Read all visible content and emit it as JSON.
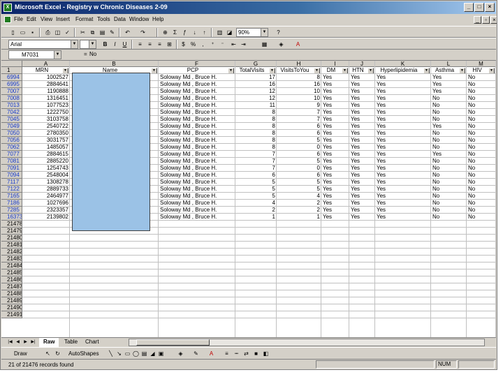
{
  "window": {
    "title": "Microsoft Excel - Registry w Chronic Diseases 2-09",
    "minimize": "_",
    "maximize": "□",
    "close": "×"
  },
  "menu": [
    "File",
    "Edit",
    "View",
    "Insert",
    "Format",
    "Tools",
    "Data",
    "Window",
    "Help"
  ],
  "formatting": {
    "font": "Arial",
    "font_size": "10",
    "zoom": "90%"
  },
  "formula_bar": {
    "name_box": "M7031",
    "fx": "=",
    "value": "No"
  },
  "columns": [
    {
      "letter": "A",
      "header": "MRN"
    },
    {
      "letter": "B",
      "header": "Name"
    },
    {
      "letter": "F",
      "header": "PCP"
    },
    {
      "letter": "G",
      "header": "TotalVisits"
    },
    {
      "letter": "H",
      "header": "VisitsToYou"
    },
    {
      "letter": "I",
      "header": "DM"
    },
    {
      "letter": "J",
      "header": "HTN"
    },
    {
      "letter": "K",
      "header": "Hyperlipidemia"
    },
    {
      "letter": "L",
      "header": "Asthma"
    },
    {
      "letter": "M",
      "header": "HIV"
    }
  ],
  "header_row_number": "1",
  "rows": [
    {
      "row": "6994",
      "mrn": "1002527",
      "pcp": "Soloway Md , Bruce H.",
      "total": "17",
      "you": "8",
      "dm": "Yes",
      "htn": "Yes",
      "hyp": "Yes",
      "asthma": "Yes",
      "hiv": "No"
    },
    {
      "row": "6995",
      "mrn": "2884641",
      "pcp": "Soloway Md , Bruce H.",
      "total": "16",
      "you": "16",
      "dm": "Yes",
      "htn": "Yes",
      "hyp": "Yes",
      "asthma": "Yes",
      "hiv": "No"
    },
    {
      "row": "7007",
      "mrn": "1190888",
      "pcp": "Soloway Md , Bruce H.",
      "total": "12",
      "you": "10",
      "dm": "Yes",
      "htn": "Yes",
      "hyp": "Yes",
      "asthma": "Yes",
      "hiv": "No"
    },
    {
      "row": "7008",
      "mrn": "1316451",
      "pcp": "Soloway Md , Bruce H.",
      "total": "12",
      "you": "10",
      "dm": "Yes",
      "htn": "Yes",
      "hyp": "Yes",
      "asthma": "No",
      "hiv": "No"
    },
    {
      "row": "7013",
      "mrn": "1077523",
      "pcp": "Soloway Md , Bruce H.",
      "total": "11",
      "you": "9",
      "dm": "Yes",
      "htn": "Yes",
      "hyp": "Yes",
      "asthma": "No",
      "hiv": "No"
    },
    {
      "row": "7042",
      "mrn": "1222750",
      "pcp": "Soloway Md , Bruce H.",
      "total": "8",
      "you": "7",
      "dm": "Yes",
      "htn": "Yes",
      "hyp": "Yes",
      "asthma": "No",
      "hiv": "No"
    },
    {
      "row": "7045",
      "mrn": "3103758",
      "pcp": "Soloway Md , Bruce H.",
      "total": "8",
      "you": "7",
      "dm": "Yes",
      "htn": "Yes",
      "hyp": "Yes",
      "asthma": "No",
      "hiv": "No"
    },
    {
      "row": "7049",
      "mrn": "2540722",
      "pcp": "Soloway Md , Bruce H.",
      "total": "8",
      "you": "6",
      "dm": "Yes",
      "htn": "Yes",
      "hyp": "Yes",
      "asthma": "Yes",
      "hiv": "No"
    },
    {
      "row": "7050",
      "mrn": "2780350",
      "pcp": "Soloway Md , Bruce H.",
      "total": "8",
      "you": "6",
      "dm": "Yes",
      "htn": "Yes",
      "hyp": "Yes",
      "asthma": "No",
      "hiv": "No"
    },
    {
      "row": "7056",
      "mrn": "3031757",
      "pcp": "Soloway Md , Bruce H.",
      "total": "8",
      "you": "5",
      "dm": "Yes",
      "htn": "Yes",
      "hyp": "Yes",
      "asthma": "No",
      "hiv": "No"
    },
    {
      "row": "7062",
      "mrn": "1485057",
      "pcp": "Soloway Md , Bruce H.",
      "total": "8",
      "you": "0",
      "dm": "Yes",
      "htn": "Yes",
      "hyp": "Yes",
      "asthma": "No",
      "hiv": "No"
    },
    {
      "row": "7077",
      "mrn": "2884615",
      "pcp": "Soloway Md , Bruce H.",
      "total": "7",
      "you": "6",
      "dm": "Yes",
      "htn": "Yes",
      "hyp": "Yes",
      "asthma": "Yes",
      "hiv": "No"
    },
    {
      "row": "7081",
      "mrn": "2885220",
      "pcp": "Soloway Md , Bruce H.",
      "total": "7",
      "you": "5",
      "dm": "Yes",
      "htn": "Yes",
      "hyp": "Yes",
      "asthma": "No",
      "hiv": "No"
    },
    {
      "row": "7091",
      "mrn": "1254743",
      "pcp": "Soloway Md , Bruce H.",
      "total": "7",
      "you": "0",
      "dm": "Yes",
      "htn": "Yes",
      "hyp": "Yes",
      "asthma": "No",
      "hiv": "No"
    },
    {
      "row": "7094",
      "mrn": "2548004",
      "pcp": "Soloway Md , Bruce H.",
      "total": "6",
      "you": "6",
      "dm": "Yes",
      "htn": "Yes",
      "hyp": "Yes",
      "asthma": "No",
      "hiv": "No"
    },
    {
      "row": "7117",
      "mrn": "1308278",
      "pcp": "Soloway Md , Bruce H.",
      "total": "5",
      "you": "5",
      "dm": "Yes",
      "htn": "Yes",
      "hyp": "Yes",
      "asthma": "No",
      "hiv": "No"
    },
    {
      "row": "7122",
      "mrn": "2889733",
      "pcp": "Soloway Md , Bruce H.",
      "total": "5",
      "you": "5",
      "dm": "Yes",
      "htn": "Yes",
      "hyp": "Yes",
      "asthma": "No",
      "hiv": "No"
    },
    {
      "row": "7165",
      "mrn": "2464977",
      "pcp": "Soloway Md , Bruce H.",
      "total": "5",
      "you": "4",
      "dm": "Yes",
      "htn": "Yes",
      "hyp": "Yes",
      "asthma": "No",
      "hiv": "No"
    },
    {
      "row": "7186",
      "mrn": "1027696",
      "pcp": "Soloway Md , Bruce H.",
      "total": "4",
      "you": "2",
      "dm": "Yes",
      "htn": "Yes",
      "hyp": "Yes",
      "asthma": "No",
      "hiv": "No"
    },
    {
      "row": "7285",
      "mrn": "2323357",
      "pcp": "Soloway Md , Bruce H.",
      "total": "2",
      "you": "2",
      "dm": "Yes",
      "htn": "Yes",
      "hyp": "Yes",
      "asthma": "No",
      "hiv": "No"
    },
    {
      "row": "16373",
      "mrn": "2139802",
      "pcp": "Soloway Md , Bruce H.",
      "total": "1",
      "you": "1",
      "dm": "Yes",
      "htn": "Yes",
      "hyp": "Yes",
      "asthma": "No",
      "hiv": "No"
    }
  ],
  "empty_rows": [
    "21478",
    "21479",
    "21480",
    "21481",
    "21482",
    "21483",
    "21484",
    "21485",
    "21486",
    "21487",
    "21488",
    "21489",
    "21490",
    "21491"
  ],
  "sheet_tabs": [
    "Raw",
    "Table",
    "Chart"
  ],
  "active_tab": "Raw",
  "draw_toolbar": {
    "draw": "Draw",
    "autoshapes": "AutoShapes"
  },
  "status": {
    "text": "21 of 21476 records found",
    "num": "NUM"
  },
  "colors": {
    "redaction": "#9bc2e6",
    "row_number_filtered": "#1a3cc8"
  }
}
